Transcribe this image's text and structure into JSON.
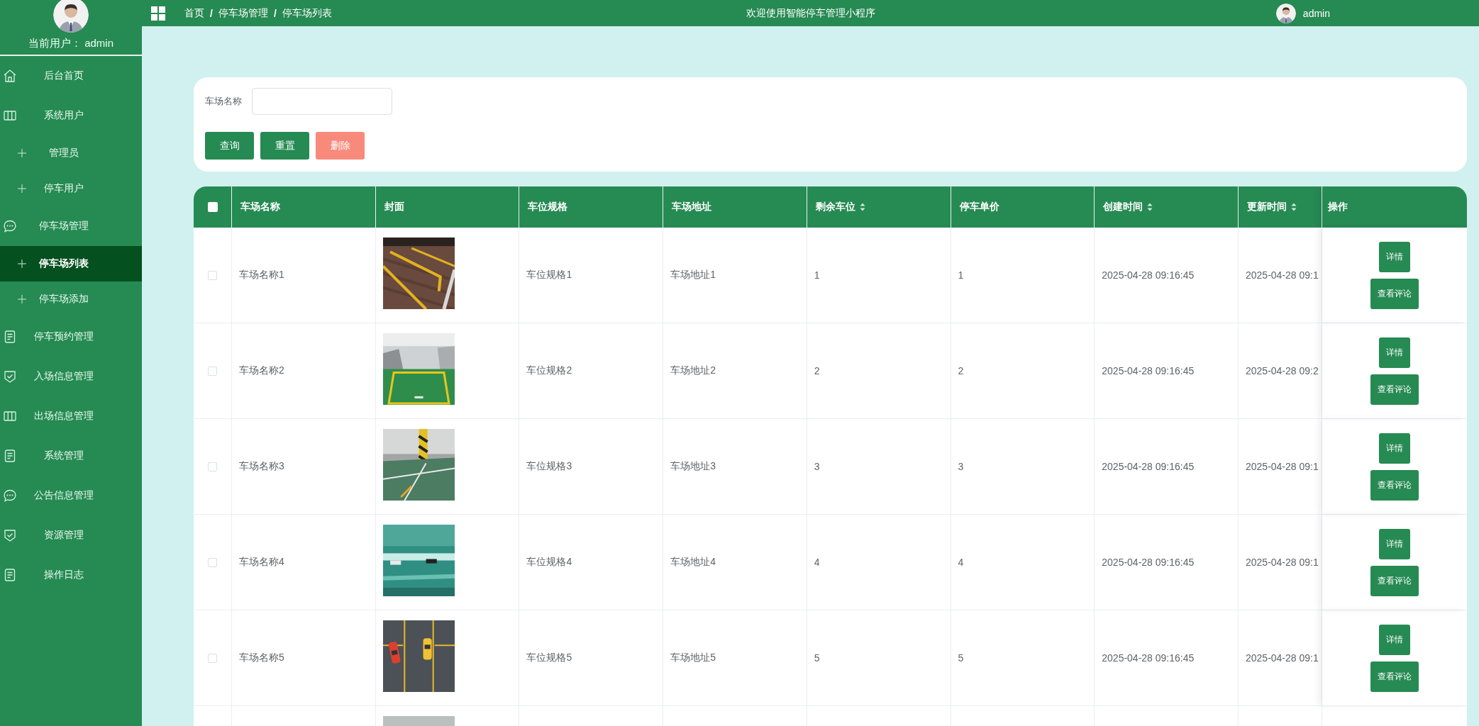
{
  "sidebar": {
    "user_label": "当前用户： admin",
    "menu": [
      {
        "label": "后台首页",
        "kind": "home",
        "selected": false
      },
      {
        "label": "系统用户",
        "kind": "columns",
        "selected": false,
        "children": [
          {
            "label": "管理员",
            "selected": false
          },
          {
            "label": "停车用户",
            "selected": false
          }
        ]
      },
      {
        "label": "停车场管理",
        "kind": "chat",
        "selected": false,
        "children": [
          {
            "label": "停车场列表",
            "selected": true
          },
          {
            "label": "停车场添加",
            "selected": false
          }
        ]
      },
      {
        "label": "停车预约管理",
        "kind": "doc",
        "selected": false
      },
      {
        "label": "入场信息管理",
        "kind": "shield",
        "selected": false
      },
      {
        "label": "出场信息管理",
        "kind": "columns",
        "selected": false
      },
      {
        "label": "系统管理",
        "kind": "doc",
        "selected": false
      },
      {
        "label": "公告信息管理",
        "kind": "chat",
        "selected": false
      },
      {
        "label": "资源管理",
        "kind": "shield",
        "selected": false
      },
      {
        "label": "操作日志",
        "kind": "doc",
        "selected": false
      }
    ]
  },
  "header": {
    "breadcrumb": [
      "首页",
      "停车场管理",
      "停车场列表"
    ],
    "separator": "/",
    "welcome": "欢迎使用智能停车管理小程序",
    "user_name": "admin"
  },
  "search": {
    "label": "车场名称",
    "buttons": [
      {
        "label": "查询",
        "kind": "search"
      },
      {
        "label": "重置",
        "kind": "reset"
      },
      {
        "label": "删除",
        "kind": "delete"
      }
    ]
  },
  "table": {
    "select_all": {
      "checked": false
    },
    "columns": [
      {
        "label": "车场名称",
        "sortable": false
      },
      {
        "label": "封面",
        "sortable": false
      },
      {
        "label": "车位规格",
        "sortable": false
      },
      {
        "label": "车场地址",
        "sortable": false
      },
      {
        "label": "剩余车位",
        "sortable": true
      },
      {
        "label": "停车单价",
        "sortable": false
      },
      {
        "label": "创建时间",
        "sortable": true
      },
      {
        "label": "更新时间",
        "sortable": true
      },
      {
        "label": "操作",
        "sortable": false
      }
    ],
    "rows": [
      {
        "checked": false,
        "name": "车场名称1",
        "cover": {
          "kind": "picture"
        },
        "spec": "车位规格1",
        "address": "车场地址1",
        "remaining": "1",
        "price": "1",
        "created": "2025-04-28 09:16:45",
        "updated": "2025-04-28 09:1",
        "actions": [
          "详情",
          "查看评论"
        ]
      },
      {
        "checked": false,
        "name": "车场名称2",
        "cover": {
          "kind": "picture"
        },
        "spec": "车位规格2",
        "address": "车场地址2",
        "remaining": "2",
        "price": "2",
        "created": "2025-04-28 09:16:45",
        "updated": "2025-04-28 09:2",
        "actions": [
          "详情",
          "查看评论"
        ]
      },
      {
        "checked": false,
        "name": "车场名称3",
        "cover": {
          "kind": "picture"
        },
        "spec": "车位规格3",
        "address": "车场地址3",
        "remaining": "3",
        "price": "3",
        "created": "2025-04-28 09:16:45",
        "updated": "2025-04-28 09:1",
        "actions": [
          "详情",
          "查看评论"
        ]
      },
      {
        "checked": false,
        "name": "车场名称4",
        "cover": {
          "kind": "picture"
        },
        "spec": "车位规格4",
        "address": "车场地址4",
        "remaining": "4",
        "price": "4",
        "created": "2025-04-28 09:16:45",
        "updated": "2025-04-28 09:1",
        "actions": [
          "详情",
          "查看评论"
        ]
      },
      {
        "checked": false,
        "name": "车场名称5",
        "cover": {
          "kind": "picture"
        },
        "spec": "车位规格5",
        "address": "车场地址5",
        "remaining": "5",
        "price": "5",
        "created": "2025-04-28 09:16:45",
        "updated": "2025-04-28 09:1",
        "actions": [
          "详情",
          "查看评论"
        ]
      },
      {
        "cover": {
          "kind": "picture"
        }
      }
    ]
  }
}
